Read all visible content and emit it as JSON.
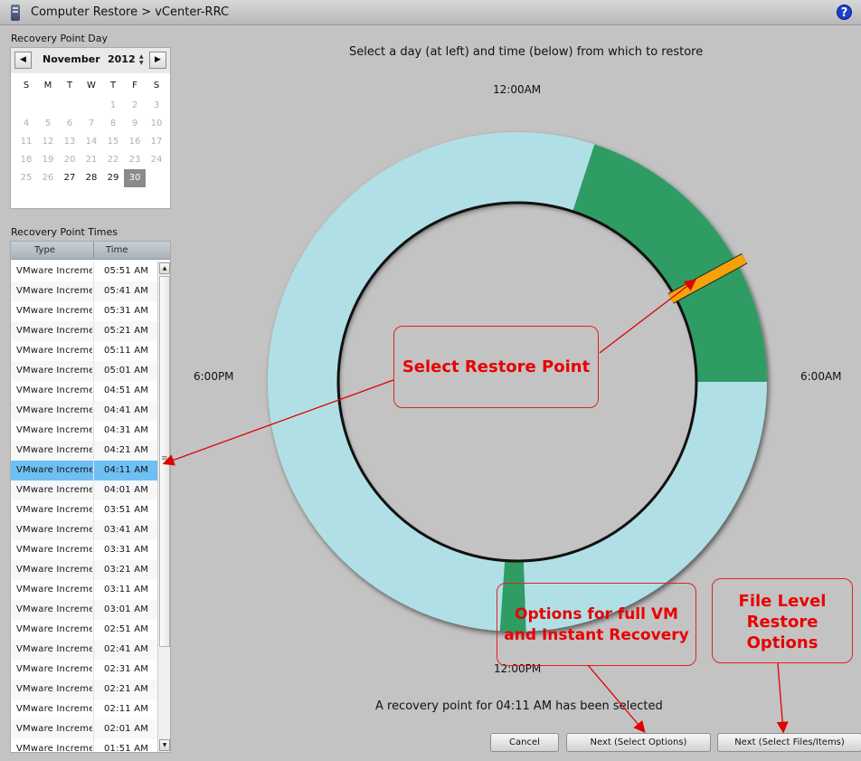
{
  "titlebar": {
    "title": "Computer Restore  >  vCenter-RRC",
    "help": "?"
  },
  "calendar": {
    "label": "Recovery Point Day",
    "prev": "◀",
    "next": "▶",
    "month": "November",
    "year": "2012",
    "weekdays": [
      "S",
      "M",
      "T",
      "W",
      "T",
      "F",
      "S"
    ],
    "days": [
      {
        "d": "",
        "s": "inactive"
      },
      {
        "d": "",
        "s": "inactive"
      },
      {
        "d": "",
        "s": "inactive"
      },
      {
        "d": "",
        "s": "inactive"
      },
      {
        "d": "1",
        "s": "inactive"
      },
      {
        "d": "2",
        "s": "inactive"
      },
      {
        "d": "3",
        "s": "inactive"
      },
      {
        "d": "4",
        "s": "inactive"
      },
      {
        "d": "5",
        "s": "inactive"
      },
      {
        "d": "6",
        "s": "inactive"
      },
      {
        "d": "7",
        "s": "inactive"
      },
      {
        "d": "8",
        "s": "inactive"
      },
      {
        "d": "9",
        "s": "inactive"
      },
      {
        "d": "10",
        "s": "inactive"
      },
      {
        "d": "11",
        "s": "inactive"
      },
      {
        "d": "12",
        "s": "inactive"
      },
      {
        "d": "13",
        "s": "inactive"
      },
      {
        "d": "14",
        "s": "inactive"
      },
      {
        "d": "15",
        "s": "inactive"
      },
      {
        "d": "16",
        "s": "inactive"
      },
      {
        "d": "17",
        "s": "inactive"
      },
      {
        "d": "18",
        "s": "inactive"
      },
      {
        "d": "19",
        "s": "inactive"
      },
      {
        "d": "20",
        "s": "inactive"
      },
      {
        "d": "21",
        "s": "inactive"
      },
      {
        "d": "22",
        "s": "inactive"
      },
      {
        "d": "23",
        "s": "inactive"
      },
      {
        "d": "24",
        "s": "inactive"
      },
      {
        "d": "25",
        "s": "inactive"
      },
      {
        "d": "26",
        "s": "inactive"
      },
      {
        "d": "27",
        "s": "active"
      },
      {
        "d": "28",
        "s": "active"
      },
      {
        "d": "29",
        "s": "active"
      },
      {
        "d": "30",
        "s": "selected"
      }
    ]
  },
  "times": {
    "label": "Recovery Point Times",
    "col_type": "Type",
    "col_time": "Time",
    "selected_index": 10,
    "rows": [
      {
        "type": "VMware Incremental",
        "time": "05:51 AM"
      },
      {
        "type": "VMware Incremental",
        "time": "05:41 AM"
      },
      {
        "type": "VMware Incremental",
        "time": "05:31 AM"
      },
      {
        "type": "VMware Incremental",
        "time": "05:21 AM"
      },
      {
        "type": "VMware Incremental",
        "time": "05:11 AM"
      },
      {
        "type": "VMware Incremental",
        "time": "05:01 AM"
      },
      {
        "type": "VMware Incremental",
        "time": "04:51 AM"
      },
      {
        "type": "VMware Incremental",
        "time": "04:41 AM"
      },
      {
        "type": "VMware Incremental",
        "time": "04:31 AM"
      },
      {
        "type": "VMware Incremental",
        "time": "04:21 AM"
      },
      {
        "type": "VMware Incremental",
        "time": "04:11 AM"
      },
      {
        "type": "VMware Incremental",
        "time": "04:01 AM"
      },
      {
        "type": "VMware Incremental",
        "time": "03:51 AM"
      },
      {
        "type": "VMware Incremental",
        "time": "03:41 AM"
      },
      {
        "type": "VMware Incremental",
        "time": "03:31 AM"
      },
      {
        "type": "VMware Incremental",
        "time": "03:21 AM"
      },
      {
        "type": "VMware Incremental",
        "time": "03:11 AM"
      },
      {
        "type": "VMware Incremental",
        "time": "03:01 AM"
      },
      {
        "type": "VMware Incremental",
        "time": "02:51 AM"
      },
      {
        "type": "VMware Incremental",
        "time": "02:41 AM"
      },
      {
        "type": "VMware Incremental",
        "time": "02:31 AM"
      },
      {
        "type": "VMware Incremental",
        "time": "02:21 AM"
      },
      {
        "type": "VMware Incremental",
        "time": "02:11 AM"
      },
      {
        "type": "VMware Incremental",
        "time": "02:01 AM"
      },
      {
        "type": "VMware Incremental",
        "time": "01:51 AM"
      }
    ]
  },
  "main": {
    "instruction": "Select a day (at left) and time (below) from which to restore",
    "clock": {
      "top": "12:00AM",
      "right": "6:00AM",
      "left": "6:00PM",
      "bottom": "12:00PM",
      "colors": {
        "empty": "#b0e0e6",
        "available": "#2e9c63",
        "marker": "#f5a20a"
      }
    },
    "status": "A recovery point for 04:11 AM has been selected"
  },
  "buttons": {
    "cancel": "Cancel",
    "next_options": "Next (Select Options)",
    "next_files": "Next (Select Files/Items)"
  },
  "callouts": {
    "restore_point": "Select Restore Point",
    "vm_options": "Options for full VM and Instant Recovery",
    "file_options": "File Level Restore Options"
  }
}
